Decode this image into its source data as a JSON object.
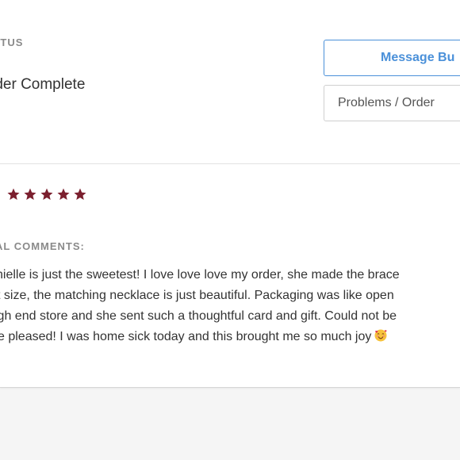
{
  "order_status": {
    "label": "ATUS",
    "value": "rder Complete"
  },
  "actions": {
    "message_label": "Message Bu",
    "problems_label": "Problems / Order"
  },
  "review": {
    "rating": 5,
    "rating_max": 5,
    "star_color": "#7b1f2e",
    "comments_label": "AL COMMENTS:",
    "comment_lines": [
      "nielle is just the sweetest! I love love love my order, she made the brace",
      "t size, the matching necklace is just beautiful. Packaging was like open",
      "igh end store and she sent such a thoughtful card and gift. Could not be",
      "e pleased! I was home sick today and this brought me so much joy"
    ],
    "emoji_icon": "smiling-face-with-hearts-icon"
  },
  "colors": {
    "accent": "#4a90d9",
    "text": "#333333",
    "muted": "#8a8a8a",
    "background": "#f5f5f5"
  }
}
